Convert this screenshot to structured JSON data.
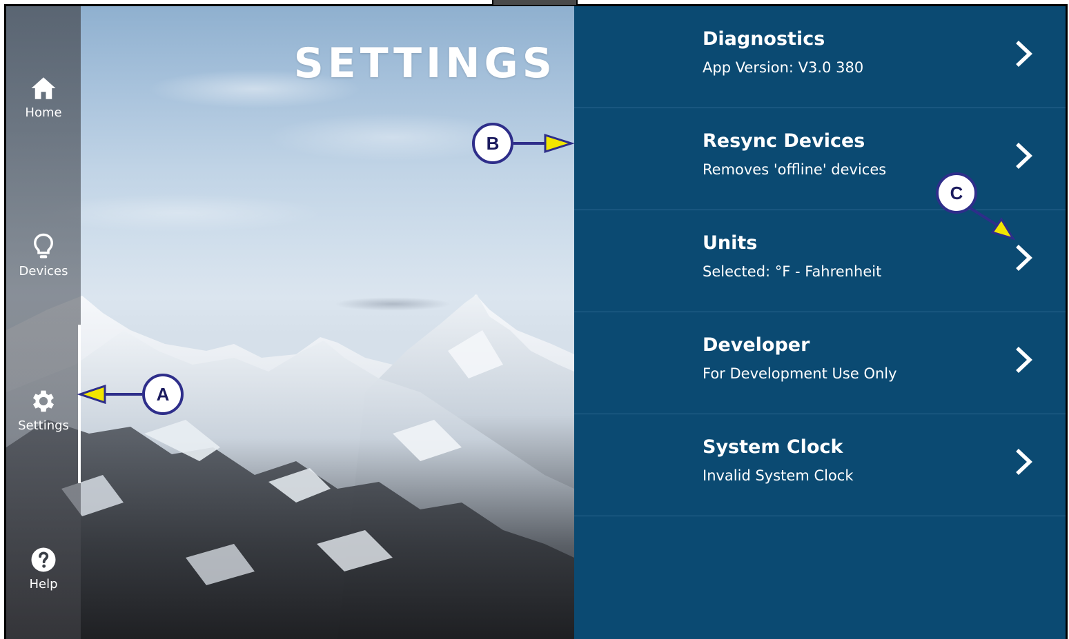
{
  "page": {
    "title": "SETTINGS"
  },
  "sidenav": {
    "items": [
      {
        "label": "Home",
        "icon": "home-icon"
      },
      {
        "label": "Devices",
        "icon": "lightbulb-icon"
      },
      {
        "label": "Settings",
        "icon": "gear-icon",
        "active": true
      },
      {
        "label": "Help",
        "icon": "help-icon"
      }
    ]
  },
  "settings": {
    "rows": [
      {
        "title": "Diagnostics",
        "subtitle": "App Version: V3.0 380"
      },
      {
        "title": "Resync Devices",
        "subtitle": "Removes 'offline' devices"
      },
      {
        "title": "Units",
        "subtitle": "Selected: °F - Fahrenheit"
      },
      {
        "title": "Developer",
        "subtitle": "For Development Use Only"
      },
      {
        "title": "System Clock",
        "subtitle": "Invalid System Clock"
      }
    ]
  },
  "callouts": {
    "a": "A",
    "b": "B",
    "c": "C"
  },
  "colors": {
    "panel_bg": "#0b4a72",
    "divider": "#2b6690",
    "callout_border": "#2e2e8a",
    "callout_arrowhead": "#f2e600",
    "text": "#ffffff"
  }
}
